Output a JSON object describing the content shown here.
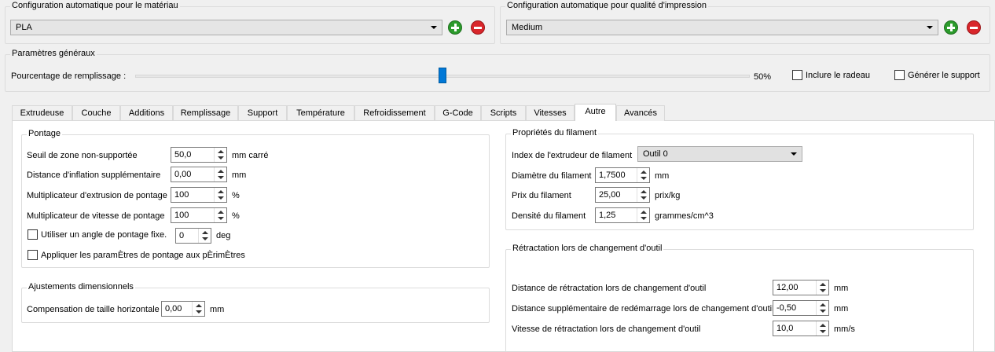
{
  "material_config": {
    "title": "Configuration automatique pour le matériau",
    "selected": "PLA"
  },
  "quality_config": {
    "title": "Configuration automatique pour qualité d'impression",
    "selected": "Medium"
  },
  "general": {
    "title": "Paramètres généraux",
    "infill_label": "Pourcentage de remplissage :",
    "infill_value": "50%",
    "infill_fraction": 0.5,
    "raft_label": "Inclure le radeau",
    "raft_checked": false,
    "support_label": "Générer le support",
    "support_checked": false
  },
  "tabs": [
    {
      "label": "Extrudeuse"
    },
    {
      "label": "Couche"
    },
    {
      "label": "Additions"
    },
    {
      "label": "Remplissage"
    },
    {
      "label": "Support"
    },
    {
      "label": "Température"
    },
    {
      "label": "Refroidissement"
    },
    {
      "label": "G-Code"
    },
    {
      "label": "Scripts"
    },
    {
      "label": "Vitesses"
    },
    {
      "label": "Autre"
    },
    {
      "label": "Avancés"
    }
  ],
  "active_tab": "Autre",
  "bridging": {
    "title": "Pontage",
    "fields": [
      {
        "label": "Seuil de zone non-supportée",
        "value": "50,0",
        "unit": "mm carré"
      },
      {
        "label": "Distance d'inflation supplémentaire",
        "value": "0,00",
        "unit": "mm"
      },
      {
        "label": "Multiplicateur d'extrusion de pontage",
        "value": "100",
        "unit": "%"
      },
      {
        "label": "Multiplicateur de vitesse de pontage",
        "value": "100",
        "unit": "%"
      }
    ],
    "angle_label": "Utiliser un angle de pontage fixe.",
    "angle_value": "0",
    "angle_unit": "deg",
    "perimeter_label": "Appliquer les paramÈtres de pontage aux pÈrimÈtres"
  },
  "dimensional": {
    "title": "Ajustements dimensionnels",
    "label": "Compensation de taille horizontale",
    "value": "0,00",
    "unit": "mm"
  },
  "filament": {
    "title": "Propriétés du filament",
    "extruder_label": "Index de l'extrudeur de filament",
    "extruder_value": "Outil 0",
    "fields": [
      {
        "label": "Diamètre du filament",
        "value": "1,7500",
        "unit": "mm"
      },
      {
        "label": "Prix du filament",
        "value": "25,00",
        "unit": "prix/kg"
      },
      {
        "label": "Densité du filament",
        "value": "1,25",
        "unit": "grammes/cm^3"
      }
    ]
  },
  "toolchange": {
    "title": "Rétractation lors de changement d'outil",
    "fields": [
      {
        "label": "Distance de rétractation lors de changement d'outil",
        "value": "12,00",
        "unit": "mm"
      },
      {
        "label": "Distance supplémentaire de redémarrage lors de changement d'outil",
        "value": "-0,50",
        "unit": "mm"
      },
      {
        "label": "Vitesse de rétractation lors de changement d'outil",
        "value": "10,0",
        "unit": "mm/s"
      }
    ]
  }
}
